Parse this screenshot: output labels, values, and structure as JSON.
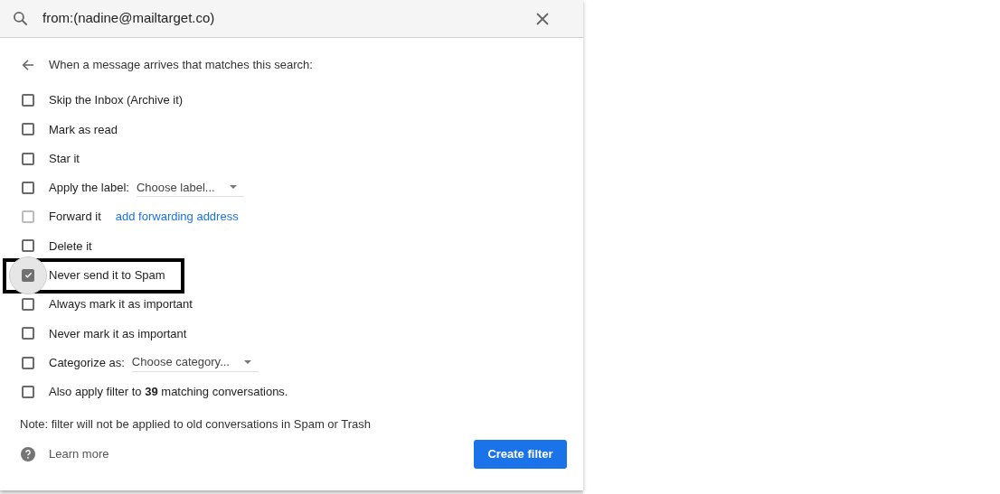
{
  "search": {
    "value": "from:(nadine@mailtarget.co)"
  },
  "header": "When a message arrives that matches this search:",
  "options": [
    {
      "kind": "checkbox",
      "label": "Skip the Inbox (Archive it)",
      "checked": false,
      "disabled": false,
      "highlighted": false
    },
    {
      "kind": "checkbox",
      "label": "Mark as read",
      "checked": false,
      "disabled": false,
      "highlighted": false
    },
    {
      "kind": "checkbox",
      "label": "Star it",
      "checked": false,
      "disabled": false,
      "highlighted": false
    },
    {
      "kind": "dropdown",
      "label": "Apply the label:",
      "placeholder": "Choose label...",
      "checked": false,
      "disabled": false,
      "highlighted": false
    },
    {
      "kind": "link",
      "label": "Forward it",
      "link": "add forwarding address",
      "checked": false,
      "disabled": true,
      "highlighted": false
    },
    {
      "kind": "checkbox",
      "label": "Delete it",
      "checked": false,
      "disabled": false,
      "highlighted": false
    },
    {
      "kind": "checkbox",
      "label": "Never send it to Spam",
      "checked": true,
      "disabled": false,
      "highlighted": true
    },
    {
      "kind": "checkbox",
      "label": "Always mark it as important",
      "checked": false,
      "disabled": false,
      "highlighted": false
    },
    {
      "kind": "checkbox",
      "label": "Never mark it as important",
      "checked": false,
      "disabled": false,
      "highlighted": false
    },
    {
      "kind": "dropdown",
      "label": "Categorize as:",
      "placeholder": "Choose category...",
      "checked": false,
      "disabled": false,
      "highlighted": false
    },
    {
      "kind": "checkbox",
      "label": "Also apply filter to **39** matching conversations.",
      "checked": false,
      "disabled": false,
      "highlighted": false
    }
  ],
  "note": "Note: filter will not be applied to old conversations in Spam or Trash",
  "learn_more": "Learn more",
  "create_button": "Create filter"
}
